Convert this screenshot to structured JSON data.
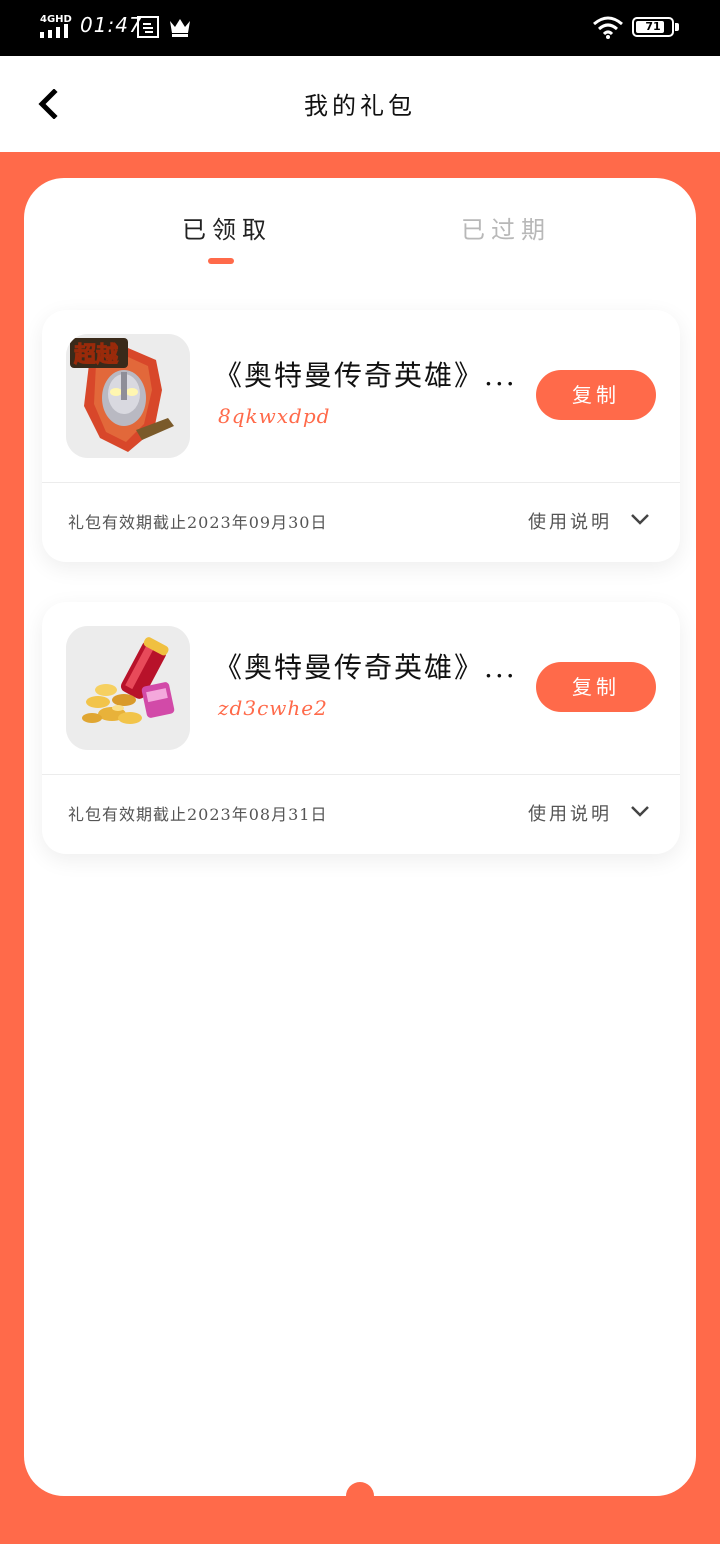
{
  "status_bar": {
    "network": "4GHD",
    "time": "01:47",
    "battery": "71"
  },
  "header": {
    "title": "我的礼包"
  },
  "tabs": [
    {
      "label": "已领取",
      "active": true
    },
    {
      "label": "已过期",
      "active": false
    }
  ],
  "gifts": [
    {
      "game_name": "《奥特曼传奇英雄》...",
      "code": "8qkwxdpd",
      "copy_label": "复制",
      "expiry": "礼包有效期截止2023年09月30日",
      "usage_label": "使用说明",
      "icon": "ultraman-game-icon"
    },
    {
      "game_name": "《奥特曼传奇英雄》...",
      "code": "zd3cwhe2",
      "copy_label": "复制",
      "expiry": "礼包有效期截止2023年08月31日",
      "usage_label": "使用说明",
      "icon": "gold-coins-game-icon"
    }
  ],
  "colors": {
    "accent": "#ff6a4a",
    "inactive_tab": "#b8b8b8",
    "status_bar_bg": "#000000"
  }
}
